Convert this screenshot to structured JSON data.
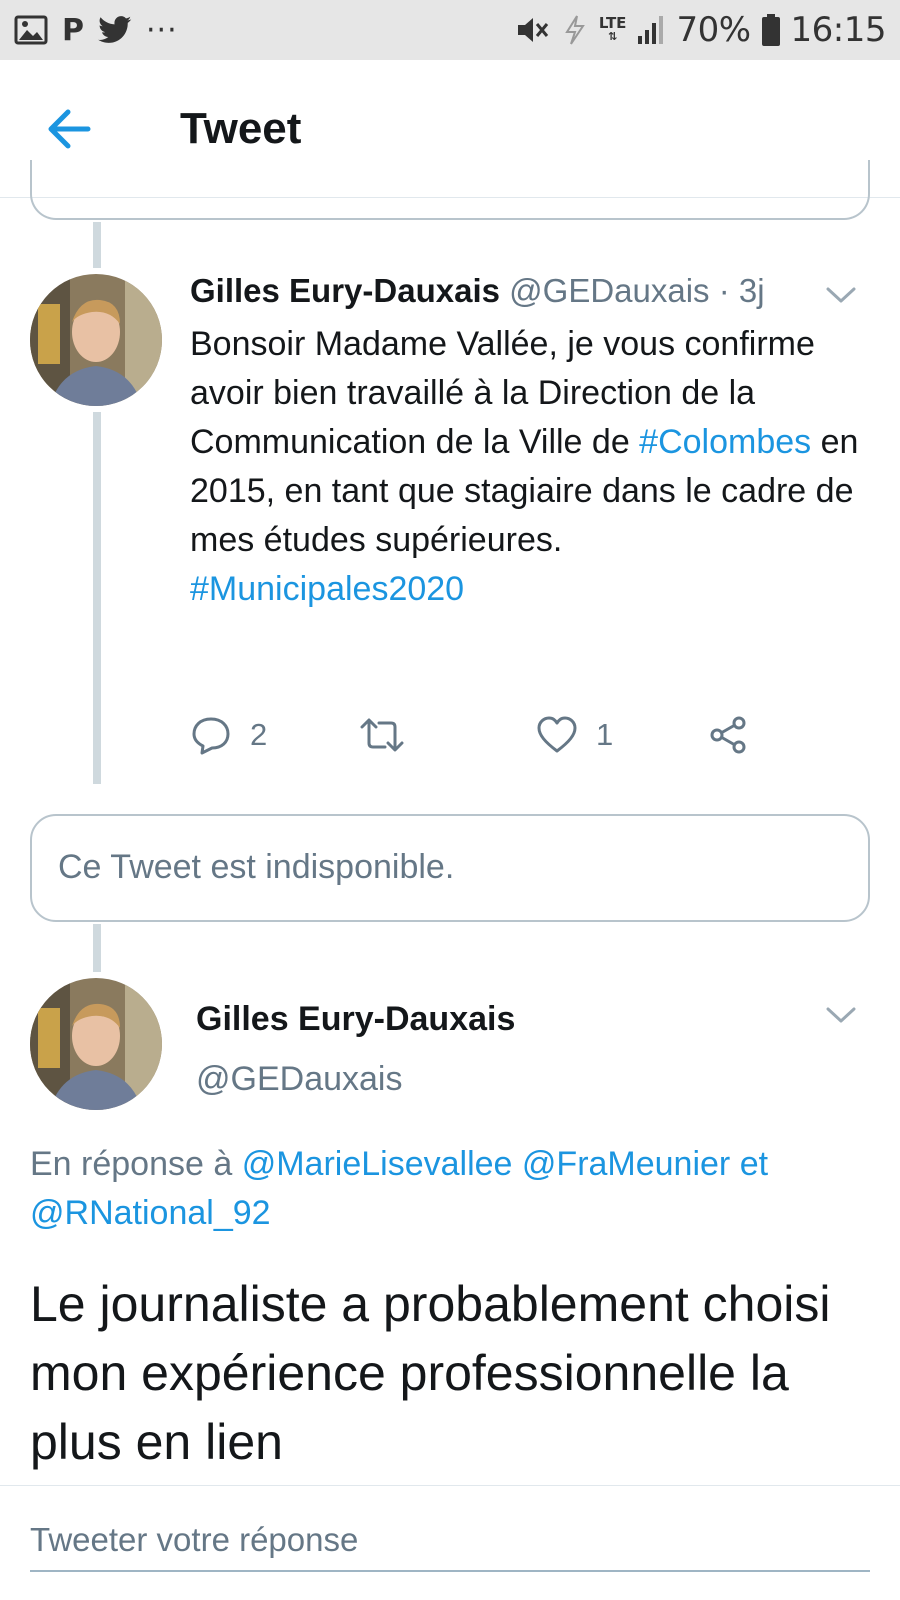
{
  "status_bar": {
    "carrier_letter": "P",
    "dots": "···",
    "network": "LTE",
    "battery": "70%",
    "time": "16:15",
    "icons": [
      "gallery-icon",
      "pinterest-icon",
      "twitter-icon",
      "more-notifications-icon",
      "mute-icon",
      "data-saver-icon",
      "signal-icon",
      "battery-icon"
    ]
  },
  "header": {
    "title": "Tweet",
    "back_icon": "back-arrow-icon"
  },
  "tweet1": {
    "name": "Gilles Eury-Dauxais",
    "handle": "@GEDauxais",
    "time": " · 3j",
    "text_part1": "Bonsoir Madame Vallée, je vous confirme avoir bien travaillé à la Direction de la Communication de la Ville de ",
    "hashtag1": "#Colombes",
    "text_part2": " en 2015, en tant que stagiaire dans le cadre de mes études supérieures.",
    "hashtag2": "#Municipales2020",
    "actions": {
      "reply_count": "2",
      "retweet_count": "",
      "like_count": "1"
    }
  },
  "unavailable": {
    "text": "Ce Tweet est indisponible."
  },
  "tweet2": {
    "name": "Gilles Eury-Dauxais",
    "handle": "@GEDauxais",
    "reply_prefix": "En réponse à ",
    "mention1": "@MarieLisevallee",
    "mention2": "@FraMeunier",
    "conjunction": " et ",
    "mention3": "@RNational_92",
    "text": "Le journaliste a probablement choisi mon expérience professionnelle la plus en lien"
  },
  "reply_bar": {
    "placeholder": "Tweeter votre réponse"
  },
  "colors": {
    "accent": "#1b95e0",
    "muted": "#657786",
    "text": "#14171a",
    "thread_line": "#cfd9de"
  }
}
